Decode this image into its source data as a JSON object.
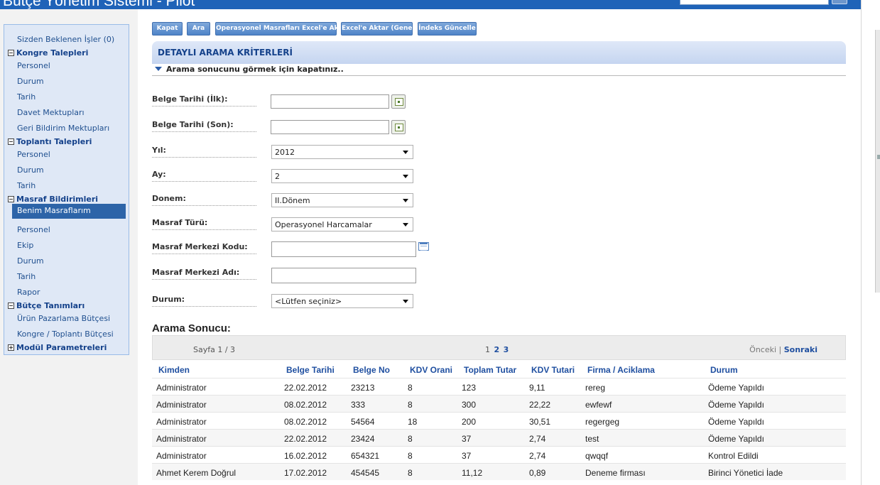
{
  "header": {
    "title": "Bütçe Yönetim Sistemi - Pilot"
  },
  "sidebar": {
    "pending": "Sizden Beklenen İşler (0)",
    "groups": {
      "kongre": {
        "label": "Kongre Talepleri",
        "items": [
          "Personel",
          "Durum",
          "Tarih",
          "Davet Mektupları",
          "Geri Bildirim Mektupları"
        ]
      },
      "toplanti": {
        "label": "Toplantı Talepleri",
        "items": [
          "Personel",
          "Durum",
          "Tarih"
        ]
      },
      "masraf": {
        "label": "Masraf Bildirimleri",
        "items": [
          "Benim Masraflarım",
          "Personel",
          "Ekip",
          "Durum",
          "Tarih",
          "Rapor"
        ]
      },
      "butce": {
        "label": "Bütçe Tanımları",
        "items": [
          "Ürün Pazarlama Bütçesi",
          "Kongre / Toplantı Bütçesi"
        ]
      },
      "modul": {
        "label": "Modül Parametreleri"
      }
    }
  },
  "toolbar": {
    "kapat": "Kapat",
    "ara": "Ara",
    "excel_opr": "Operasyonel Masrafları Excel'e Aktar",
    "excel_genel": "Excel'e Aktar (Genel)",
    "indeks": "İndeks Güncelle"
  },
  "criteria": {
    "title": "DETAYLI ARAMA KRİTERLERİ",
    "collapse_hint": "Arama sonucunu görmek için kapatınız..",
    "fields": {
      "belge_ilk": {
        "label": "Belge Tarihi (İlk):",
        "value": ""
      },
      "belge_son": {
        "label": "Belge Tarihi (Son):",
        "value": ""
      },
      "yil": {
        "label": "Yıl:",
        "value": "2012"
      },
      "ay": {
        "label": "Ay:",
        "value": "2"
      },
      "donem": {
        "label": "Donem:",
        "value": "II.Dönem"
      },
      "masraf_turu": {
        "label": "Masraf Türü:",
        "value": "Operasyonel Harcamalar"
      },
      "mm_kodu": {
        "label": "Masraf Merkezi Kodu:",
        "value": ""
      },
      "mm_adi": {
        "label": "Masraf Merkezi Adı:",
        "value": ""
      },
      "durum": {
        "label": "Durum:",
        "value": "<Lütfen seçiniz>"
      }
    }
  },
  "results": {
    "title": "Arama Sonucu:",
    "page_info": "Sayfa 1 / 3",
    "pages": [
      "1",
      "2",
      "3"
    ],
    "prev": "Önceki",
    "separator": "|",
    "next": "Sonraki",
    "columns": [
      "Kimden",
      "Belge Tarihi",
      "Belge No",
      "KDV Orani",
      "Toplam Tutar",
      "KDV Tutari",
      "Firma / Aciklama",
      "Durum"
    ],
    "rows": [
      [
        "Administrator",
        "22.02.2012",
        "23213",
        "8",
        "123",
        "9,11",
        "rereg",
        "Ödeme Yapıldı"
      ],
      [
        "Administrator",
        "08.02.2012",
        "333",
        "8",
        "300",
        "22,22",
        "ewfewf",
        "Ödeme Yapıldı"
      ],
      [
        "Administrator",
        "08.02.2012",
        "54564",
        "18",
        "200",
        "30,51",
        "regergeg",
        "Ödeme Yapıldı"
      ],
      [
        "Administrator",
        "22.02.2012",
        "23424",
        "8",
        "37",
        "2,74",
        "test",
        "Ödeme Yapıldı"
      ],
      [
        "Administrator",
        "16.02.2012",
        "654321",
        "8",
        "37",
        "2,74",
        "qwqqf",
        "Kontrol Edildi"
      ],
      [
        "Ahmet Kerem Doğrul",
        "17.02.2012",
        "454545",
        "8",
        "11,12",
        "0,89",
        "Deneme firması",
        "Birinci Yönetici İade"
      ]
    ]
  },
  "icons": {
    "calendar": "calendar-icon",
    "lookup": "lookup-list-icon",
    "dropdown": "chevron-down-icon",
    "collapse": "triangle-down-icon",
    "tree_minus": "tree-minus-icon",
    "tree_plus": "tree-plus-icon"
  },
  "colors": {
    "brand": "#1f63b8",
    "selected": "#2d64a8",
    "link": "#1f4fa0"
  }
}
